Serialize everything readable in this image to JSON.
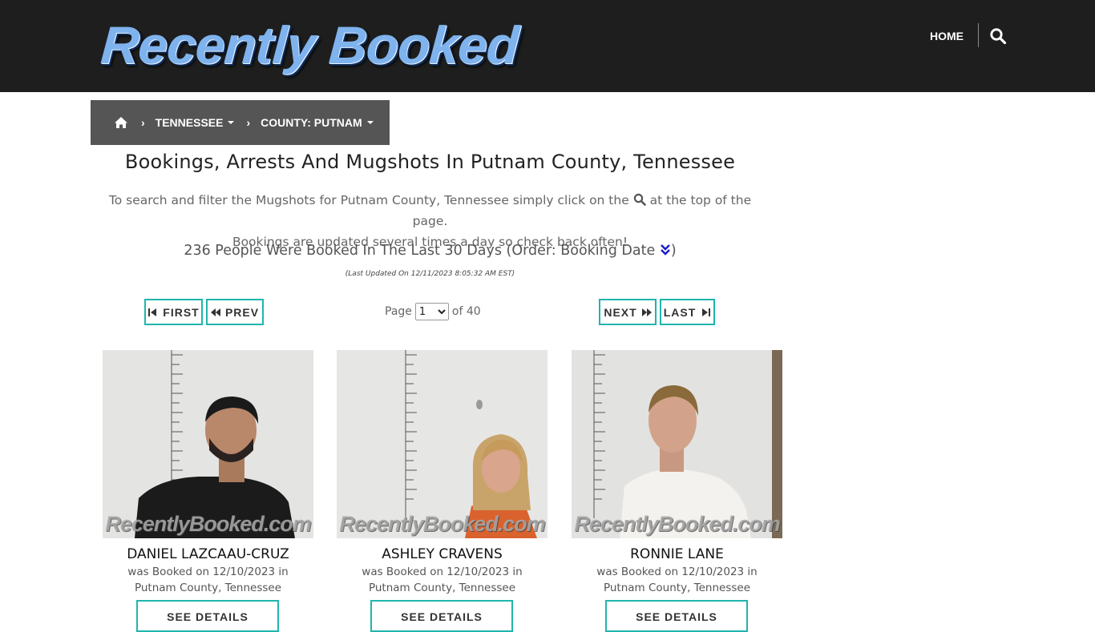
{
  "header": {
    "logo_text": "Recently Booked",
    "nav_home": "HOME",
    "search_icon": "search-icon"
  },
  "breadcrumb": {
    "home_icon": "home-icon",
    "separator": "›",
    "state": "TENNESSEE",
    "county": "COUNTY: PUTNAM"
  },
  "main": {
    "title": "Bookings, Arrests And Mugshots In Putnam County, Tennessee",
    "intro_part1": "To search and filter the Mugshots for Putnam County, Tennessee simply click on the",
    "intro_part2": "at the top of the page.",
    "intro_line2": "Bookings are updated several times a day so check back often!",
    "count_text": "236 People Were Booked In The Last 30 Days (Order: Booking Date",
    "count_close": ")",
    "last_updated": "(Last Updated On 12/11/2023 8:05:32 AM EST)"
  },
  "pager": {
    "first": "FIRST",
    "prev": "PREV",
    "next": "NEXT",
    "last": "LAST",
    "page_label": "Page",
    "current_page": "1",
    "of_label": "of 40"
  },
  "colors": {
    "accent": "#1fb5ad",
    "header_bg": "#1e1e1e",
    "breadcrumb_bg": "#555555",
    "order_icon": "#1a1acc"
  },
  "bookings": [
    {
      "name": "DANIEL LAZCAAU-CRUZ",
      "desc_line1": "was Booked on 12/10/2023 in",
      "desc_line2": "Putnam County, Tennessee",
      "watermark": "RecentlyBooked.com",
      "button": "SEE DETAILS"
    },
    {
      "name": "ASHLEY CRAVENS",
      "desc_line1": "was Booked on 12/10/2023 in",
      "desc_line2": "Putnam County, Tennessee",
      "watermark": "RecentlyBooked.com",
      "button": "SEE DETAILS"
    },
    {
      "name": "RONNIE LANE",
      "desc_line1": "was Booked on 12/10/2023 in",
      "desc_line2": "Putnam County, Tennessee",
      "watermark": "RecentlyBooked.com",
      "button": "SEE DETAILS"
    }
  ]
}
